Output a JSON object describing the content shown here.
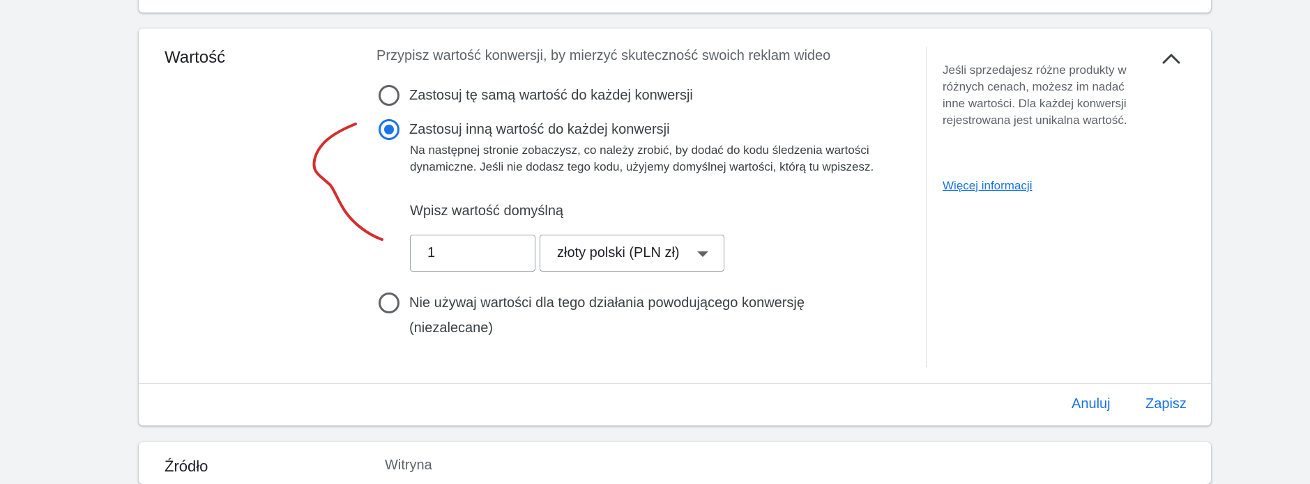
{
  "section": {
    "title": "Wartość",
    "description": "Przypisz wartość konwersji, by mierzyć skuteczność swoich reklam wideo"
  },
  "options": [
    {
      "label": "Zastosuj tę samą wartość do każdej konwersji",
      "selected": false
    },
    {
      "label": "Zastosuj inną wartość do każdej konwersji",
      "selected": true
    },
    {
      "label": "Nie używaj wartości dla tego działania powodującego konwersję (niezalecane)",
      "selected": false
    }
  ],
  "helper_text": "Na następnej stronie zobaczysz, co należy zrobić, by dodać do kodu śledzenia wartości dynamiczne. Jeśli nie dodasz tego kodu, użyjemy domyślnej wartości, którą tu wpiszesz.",
  "default_value": {
    "label": "Wpisz wartość domyślną",
    "value": "1",
    "currency": "złoty polski (PLN zł)"
  },
  "side_panel": {
    "help_text": "Jeśli sprzedajesz różne produkty w różnych cenach, możesz im nadać inne wartości. Dla każdej konwersji rejestrowana jest unikalna wartość.",
    "link": "Więcej informacji"
  },
  "footer": {
    "cancel_label": "Anuluj",
    "save_label": "Zapisz"
  },
  "next_section": {
    "title": "Źródło",
    "description": "Witryna"
  },
  "icons": {
    "collapse": "chevron-up-icon",
    "dropdown": "caret-down-icon"
  },
  "colors": {
    "accent": "#1a73e8",
    "annotation": "#d32f2f"
  }
}
